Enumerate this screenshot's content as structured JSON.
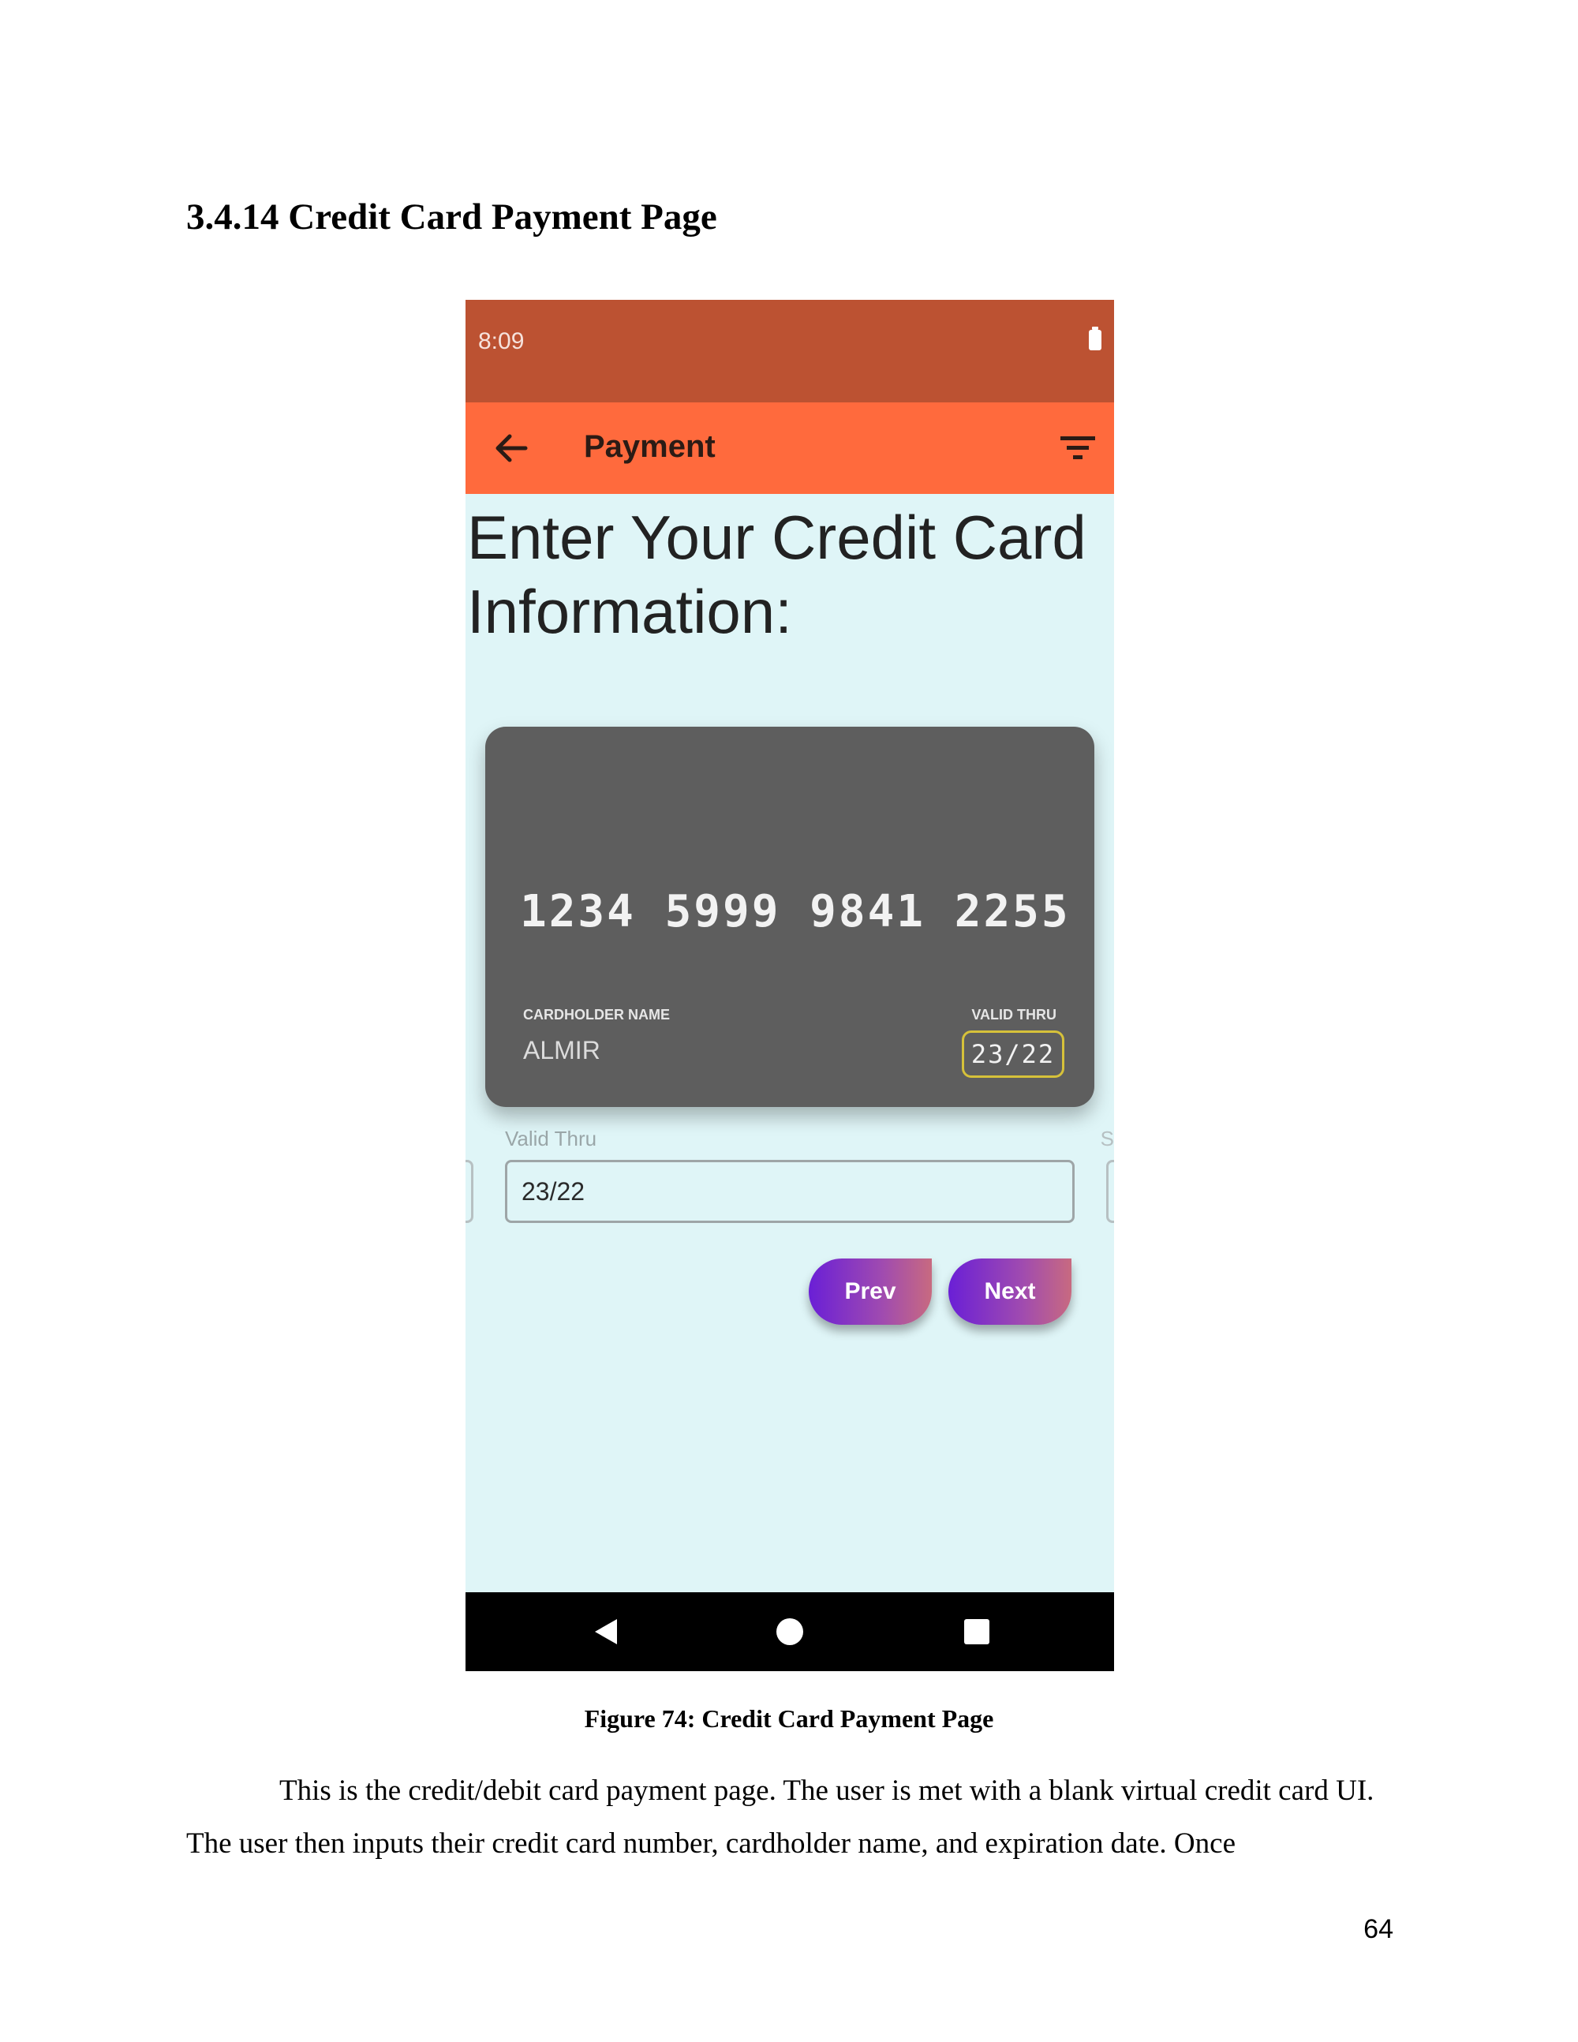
{
  "section_heading": "3.4.14 Credit Card Payment Page",
  "phone": {
    "status_bar": {
      "time": "8:09",
      "battery_icon": "battery-icon"
    },
    "app_bar": {
      "back_icon": "arrow-left-icon",
      "title": "Payment",
      "filter_icon": "filter-icon"
    },
    "heading": "Enter Your Credit Card Information:",
    "card": {
      "number": "1234 5999 9841 2255",
      "holder_label": "CARDHOLDER NAME",
      "holder_name": "ALMIR",
      "valid_label": "VALID THRU",
      "valid_value": "23/22"
    },
    "form": {
      "field_label": "Valid Thru",
      "field_value": "23/22",
      "partial_right_label": "S"
    },
    "buttons": {
      "prev": "Prev",
      "next": "Next"
    },
    "system_nav": {
      "back": "triangle-back-icon",
      "home": "circle-home-icon",
      "recent": "square-recent-icon"
    }
  },
  "figure_caption": "Figure 74: Credit Card Payment Page",
  "body_text": "This is the credit/debit card payment page. The user is met with a blank virtual credit card UI. The user then inputs their credit card number, cardholder name, and expiration date. Once",
  "page_number": "64"
}
